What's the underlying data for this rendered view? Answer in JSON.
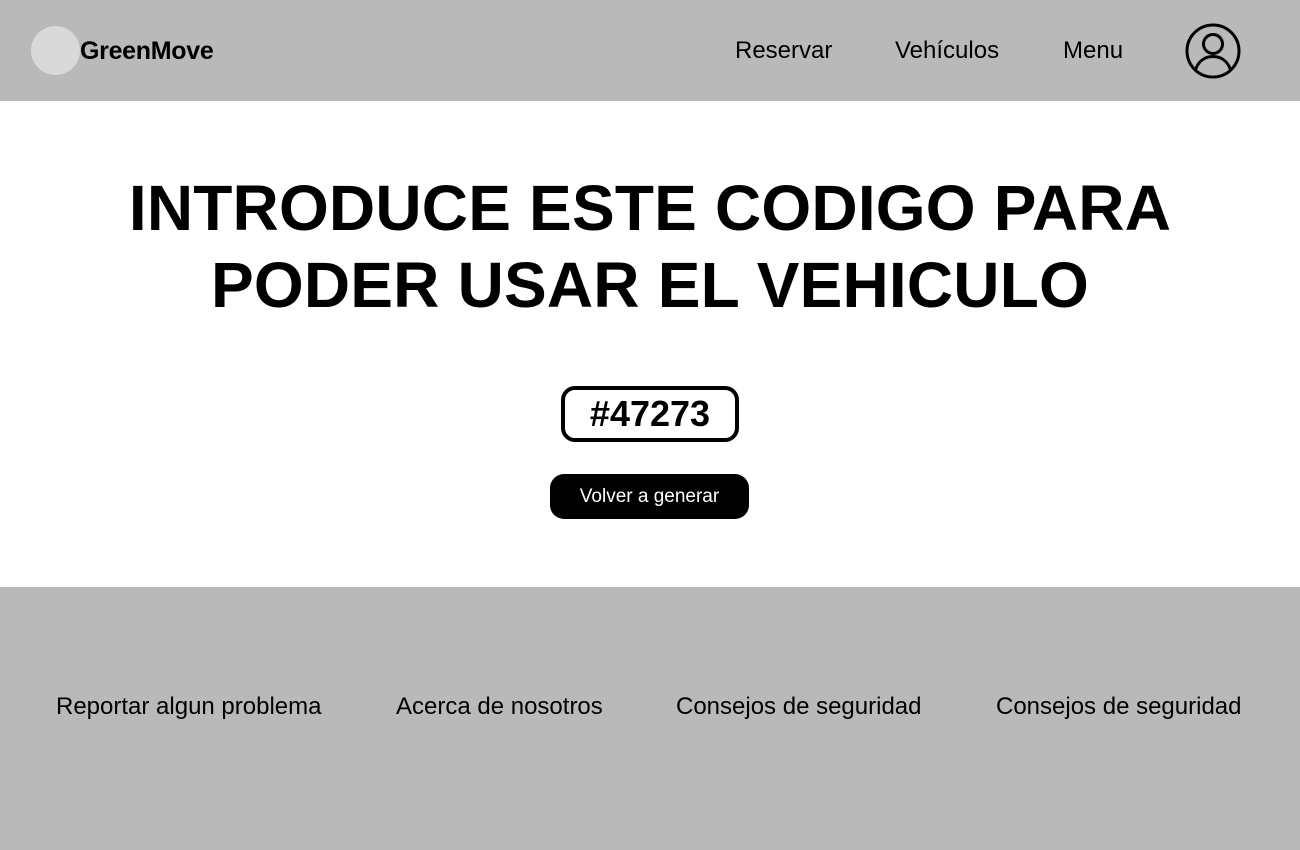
{
  "header": {
    "brand": "GreenMove",
    "nav": {
      "reservar": "Reservar",
      "vehiculos": "Vehículos",
      "menu": "Menu"
    },
    "avatar_icon": "user-circle-icon"
  },
  "main": {
    "title_line1": "INTRODUCE ESTE CODIGO PARA",
    "title_line2": "PODER USAR EL VEHICULO",
    "code": "#47273",
    "regenerate_label": "Volver a generar"
  },
  "footer": {
    "links": [
      "Reportar algun problema",
      "Acerca de nosotros",
      "Consejos de seguridad",
      "Consejos de seguridad"
    ]
  },
  "colors": {
    "bar_background": "#b9b9b9",
    "logo_circle": "#d9d9d9",
    "button_background": "#000000",
    "button_text": "#ffffff"
  }
}
